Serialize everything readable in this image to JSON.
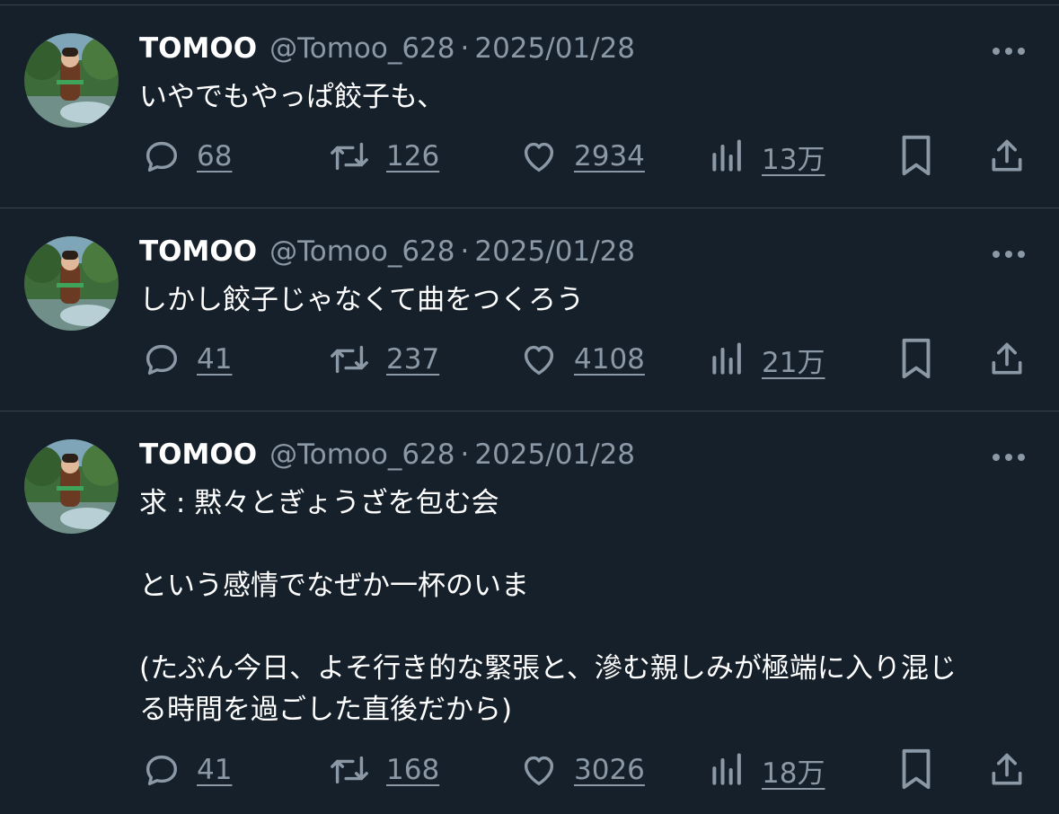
{
  "colors": {
    "background": "#15202b",
    "divider": "#38444d",
    "text_primary": "#ffffff",
    "text_secondary": "#8b98a5"
  },
  "tweets": [
    {
      "name": "TOMOO",
      "handle": "@Tomoo_628",
      "separator": "·",
      "date": "2025/01/28",
      "lines": [
        "いやでもやっぱ餃子も、"
      ],
      "replies": "68",
      "retweets": "126",
      "likes": "2934",
      "views": "13万"
    },
    {
      "name": "TOMOO",
      "handle": "@Tomoo_628",
      "separator": "·",
      "date": "2025/01/28",
      "lines": [
        "しかし餃子じゃなくて曲をつくろう"
      ],
      "replies": "41",
      "retweets": "237",
      "likes": "4108",
      "views": "21万"
    },
    {
      "name": "TOMOO",
      "handle": "@Tomoo_628",
      "separator": "·",
      "date": "2025/01/28",
      "lines": [
        "求 : 黙々とぎょうざを包む会",
        "",
        "という感情でなぜか一杯のいま",
        "",
        "(たぶん今日、よそ行き的な緊張と、滲む親しみが極端に入り混じ",
        "る時間を過ごした直後だから)"
      ],
      "replies": "41",
      "retweets": "168",
      "likes": "3026",
      "views": "18万"
    }
  ],
  "icons": {
    "avatar": "avatar-photo",
    "more": "more-dots-icon",
    "reply": "reply-bubble-icon",
    "retweet": "retweet-icon",
    "like": "heart-icon",
    "views": "views-bar-chart-icon",
    "bookmark": "bookmark-icon",
    "share": "share-upload-icon"
  }
}
